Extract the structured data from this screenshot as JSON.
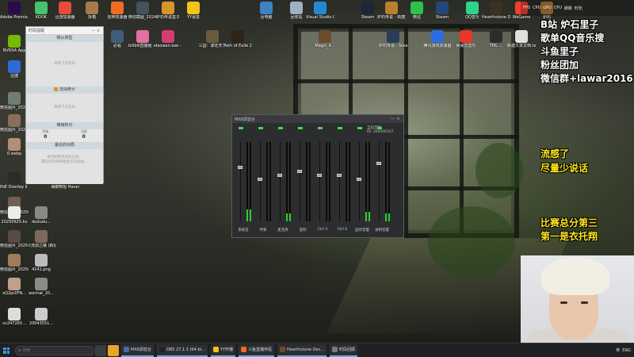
{
  "desktop_icons": [
    {
      "label": "Adobe Premie...",
      "color": "#2a0a4a"
    },
    {
      "label": "NVIDIA App",
      "color": "#76b900"
    },
    {
      "label": "迅捷",
      "color": "#2d6bd9"
    },
    {
      "label": "微信图片_2025050...",
      "color": "#6f7d72"
    },
    {
      "label": "微信图片_2025062...",
      "color": "#8a6f5c"
    },
    {
      "label": "0.webp",
      "color": "#b18f75"
    },
    {
      "label": "PoE Overlay II Standal...",
      "color": "#2b2b2b"
    },
    {
      "label": "微信图片_2025073...",
      "color": "#715f53"
    },
    {
      "label": "20250625.kx",
      "color": "#ececec"
    },
    {
      "label": "微信图片_2025062...",
      "color": "#564b45"
    },
    {
      "label": "微信图片_2025091...",
      "color": "#a07c5a"
    },
    {
      "label": "oQ2pUIFN...",
      "color": "#c0a088"
    },
    {
      "label": "sn247265...",
      "color": "#ddd"
    },
    {
      "label": "KOOK",
      "color": "#47c26f"
    },
    {
      "label": "迅游加速器",
      "color": "#e64b3b"
    },
    {
      "label": "拆箱",
      "color": "#a37b4c"
    },
    {
      "label": "雷神加速器",
      "color": "#f26b21"
    },
    {
      "label": "微信截图_2024071...",
      "color": "#41535c"
    },
    {
      "label": "炉石传说盒子",
      "color": "#d8962a"
    },
    {
      "label": "YY语音",
      "color": "#f3c316"
    },
    {
      "label": "必看",
      "color": "#425d7c"
    },
    {
      "label": "bilibili直播姬 - 快捷方式",
      "color": "#e46fa3"
    },
    {
      "label": "xiaowan.exe - 快捷方式",
      "color": "#d23e72"
    },
    {
      "label": "三国：谋定天下",
      "color": "#6b5a3c"
    },
    {
      "label": "Path of Exile 2",
      "color": "#2e2518"
    },
    {
      "label": "海康微视 Havendock",
      "color": "#355c80"
    },
    {
      "label": "dududu...",
      "color": "#888"
    },
    {
      "label": "《洗剑之路 (新版) 简介...",
      "color": "#7b6a5a"
    },
    {
      "label": "4141.png",
      "color": "#bbb"
    },
    {
      "label": "wechat_20...",
      "color": "#8a8a8a"
    },
    {
      "label": "20043551...",
      "color": "#ccc"
    },
    {
      "label": "台电脑",
      "color": "#3b83c3"
    },
    {
      "label": "回收站",
      "color": "#9fb1c2"
    },
    {
      "label": "Visual Studio Code",
      "color": "#1f8ad2"
    },
    {
      "label": "Steam",
      "color": "#1b2838"
    },
    {
      "label": "炉石传说 - 快捷方式",
      "color": "#b7822b"
    },
    {
      "label": "微信",
      "color": "#2ec24a"
    },
    {
      "label": "Steam",
      "color": "#24467a"
    },
    {
      "label": "QQ音乐",
      "color": "#2fd48b"
    },
    {
      "label": "Hearthstone Deck Tracker",
      "color": "#3f2f1f"
    },
    {
      "label": "WeGame",
      "color": "#f13e2e"
    },
    {
      "label": "炉石",
      "color": "#b27a34"
    },
    {
      "label": "Magic_4...",
      "color": "#6d4b2b"
    },
    {
      "label": "炉石传说 - Steam...",
      "color": "#2b3b5b"
    },
    {
      "label": "腾讯游戏加速器",
      "color": "#2a6fe0"
    },
    {
      "label": "网易云音乐",
      "color": "#e9352a"
    },
    {
      "label": "TPIL ...",
      "color": "#2d2d2d"
    },
    {
      "label": "新建文本文档.txt",
      "color": "#e0e0e0"
    }
  ],
  "timer_panel": {
    "title": "时段提醒",
    "sec1_header": "随从类型",
    "sec1_body": "等待下次对局",
    "sec2_header": "流派统计",
    "sec2_body": "等待下次对局",
    "sec3_header": "等级积分",
    "stats": [
      {
        "label": "开始",
        "value": "0"
      },
      {
        "label": "当前",
        "value": "0"
      }
    ],
    "sec4_header": "最近的对局",
    "sec4_body": "本时段暂无对局记录，\n最近的对局将会显示在此处。"
  },
  "mixer": {
    "title": "MX6调音台",
    "info_line1": "当前音频",
    "info_line2": "ID: 300000167",
    "channels": [
      {
        "label": "系统音",
        "level": 0.15
      },
      {
        "label": "伴奏",
        "level": 0.0
      },
      {
        "label": "麦克风",
        "level": 0.1
      },
      {
        "label": "混响",
        "level": 0.0
      },
      {
        "label": "Ctrl 3",
        "level": 0.0
      },
      {
        "label": "Ctrl 6",
        "level": 0.0
      },
      {
        "label": "监听音量",
        "level": 0.12
      },
      {
        "label": "录制音量",
        "level": 0.1
      }
    ]
  },
  "overlay": {
    "lines_white": [
      "B站 炉石里子",
      "歌单QQ音乐搜",
      "斗鱼里子",
      "粉丝团加",
      "微信群+lawar2016"
    ],
    "lines_yellow": [
      "流感了",
      "尽量少说话"
    ],
    "lines_bottom": [
      "比赛总分第三",
      "第一是衣托翔"
    ]
  },
  "tray_top": [
    "FPS",
    "CPU",
    "GPU",
    "CPU",
    "刷新",
    "时长"
  ],
  "taskbar": {
    "search_placeholder": "搜索",
    "apps": [
      {
        "label": "MX6调音台",
        "color": "#4a6aa0"
      },
      {
        "label": "OBS 27.1.3 (64-bi...",
        "color": "#222"
      },
      {
        "label": "YY开播",
        "color": "#f3c316"
      },
      {
        "label": "斗鱼直播伴侣",
        "color": "#f26b21"
      },
      {
        "label": "Hearthstone Dec...",
        "color": "#6b4a2b"
      },
      {
        "label": "时段回顾",
        "color": "#7b7b7b"
      }
    ],
    "tray": [
      "英",
      "ENG"
    ]
  }
}
